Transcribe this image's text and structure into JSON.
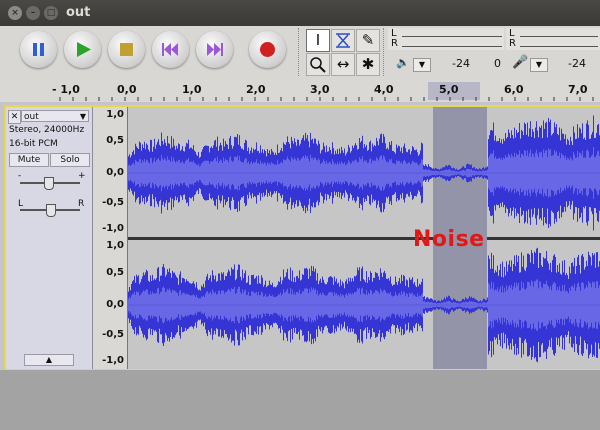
{
  "window": {
    "title": "out"
  },
  "toolbar": {
    "vol_left": "-24",
    "vol_mid": "0",
    "vol_right": "-24",
    "meter_l": "L",
    "meter_r": "R"
  },
  "ruler": {
    "labels": [
      "- 1,0",
      "0,0",
      "1,0",
      "2,0",
      "3,0",
      "4,0",
      "5,0",
      "6,0",
      "7,0"
    ]
  },
  "track": {
    "name": "out",
    "format": "Stereo, 24000Hz",
    "bitdepth": "16-bit PCM",
    "mute": "Mute",
    "solo": "Solo",
    "gain_minus": "-",
    "gain_plus": "+",
    "pan_l": "L",
    "pan_r": "R"
  },
  "scale": {
    "labels": [
      "1,0",
      "0,5",
      "0,0",
      "-0,5",
      "-1,0",
      "1,0",
      "0,5",
      "0,0",
      "-0,5",
      "-1,0"
    ]
  },
  "annotation": {
    "text": "Noise"
  },
  "colors": {
    "wave": "#3535d6",
    "wave_rms": "#6868e6",
    "selection": "#9494a8",
    "track_bg": "#c6c6c6"
  }
}
